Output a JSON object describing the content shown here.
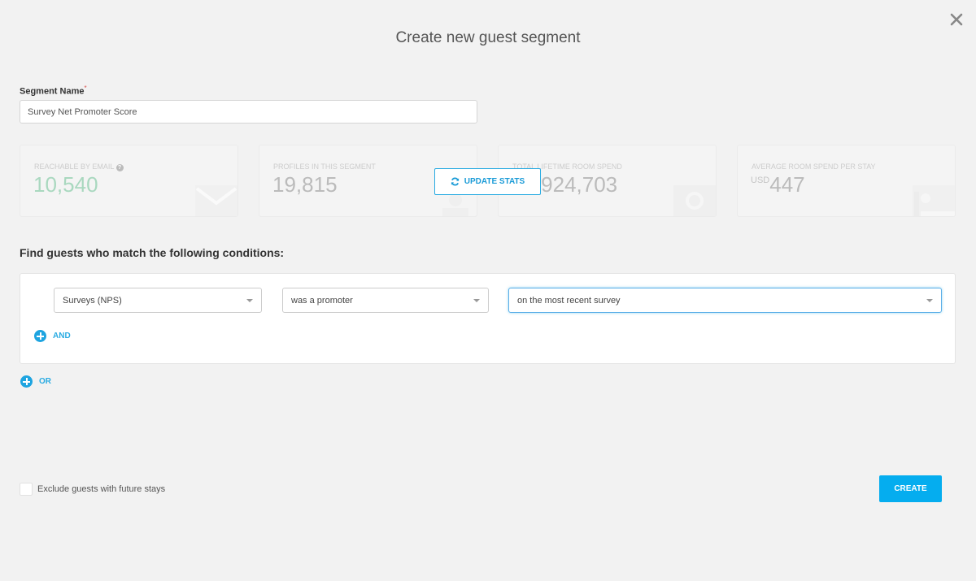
{
  "dialog": {
    "title": "Create new guest segment",
    "close_icon": "close-icon"
  },
  "segment_name": {
    "label": "Segment Name",
    "required_mark": "*",
    "value": "Survey Net Promoter Score"
  },
  "stats": [
    {
      "label": "REACHABLE BY EMAIL",
      "help_icon": "?",
      "value": "10,540",
      "currency": "",
      "icon": "envelope-icon",
      "color": "#a9d8bf"
    },
    {
      "label": "PROFILES IN THIS SEGMENT",
      "value": "19,815",
      "currency": "",
      "icon": "people-icon"
    },
    {
      "label": "TOTAL LIFETIME ROOM SPEND",
      "value": "29,924,703",
      "currency": "",
      "icon": "money-icon"
    },
    {
      "label": "AVERAGE ROOM SPEND PER STAY",
      "value": "447",
      "currency": "USD",
      "icon": "bed-icon"
    }
  ],
  "update_stats": {
    "label": "UPDATE STATS",
    "icon": "refresh-icon",
    "color": "#29abe2"
  },
  "conditions": {
    "title": "Find guests who match the following conditions:",
    "rows": [
      {
        "field": "Surveys (NPS)",
        "operator": "was a promoter",
        "qualifier": "on the most recent survey"
      }
    ],
    "and_label": "AND",
    "or_label": "OR"
  },
  "exclude_future": {
    "label": "Exclude guests with future stays",
    "checked": false
  },
  "create_button": {
    "label": "CREATE",
    "color": "#05adef"
  }
}
